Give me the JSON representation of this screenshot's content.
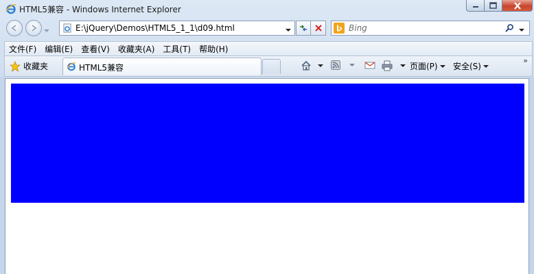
{
  "window": {
    "title": "HTML5兼容 - Windows Internet Explorer"
  },
  "address_bar": {
    "url": "E:\\jQuery\\Demos\\HTML5_1_1\\d09.html"
  },
  "search": {
    "placeholder": "Bing"
  },
  "menu": {
    "items": [
      {
        "label": "文件(F)"
      },
      {
        "label": "编辑(E)"
      },
      {
        "label": "查看(V)"
      },
      {
        "label": "收藏夹(A)"
      },
      {
        "label": "工具(T)"
      },
      {
        "label": "帮助(H)"
      }
    ]
  },
  "favorites": {
    "label": "收藏夹"
  },
  "tab": {
    "title": "HTML5兼容"
  },
  "command_bar": {
    "page_label": "页面(P)",
    "safety_label": "安全(S)"
  },
  "content": {
    "box_color": "#0000ff"
  },
  "colors": {
    "accent": "#0000ff",
    "ie_logo": "#2d7fd4",
    "bing_orange": "#f2a51a"
  }
}
